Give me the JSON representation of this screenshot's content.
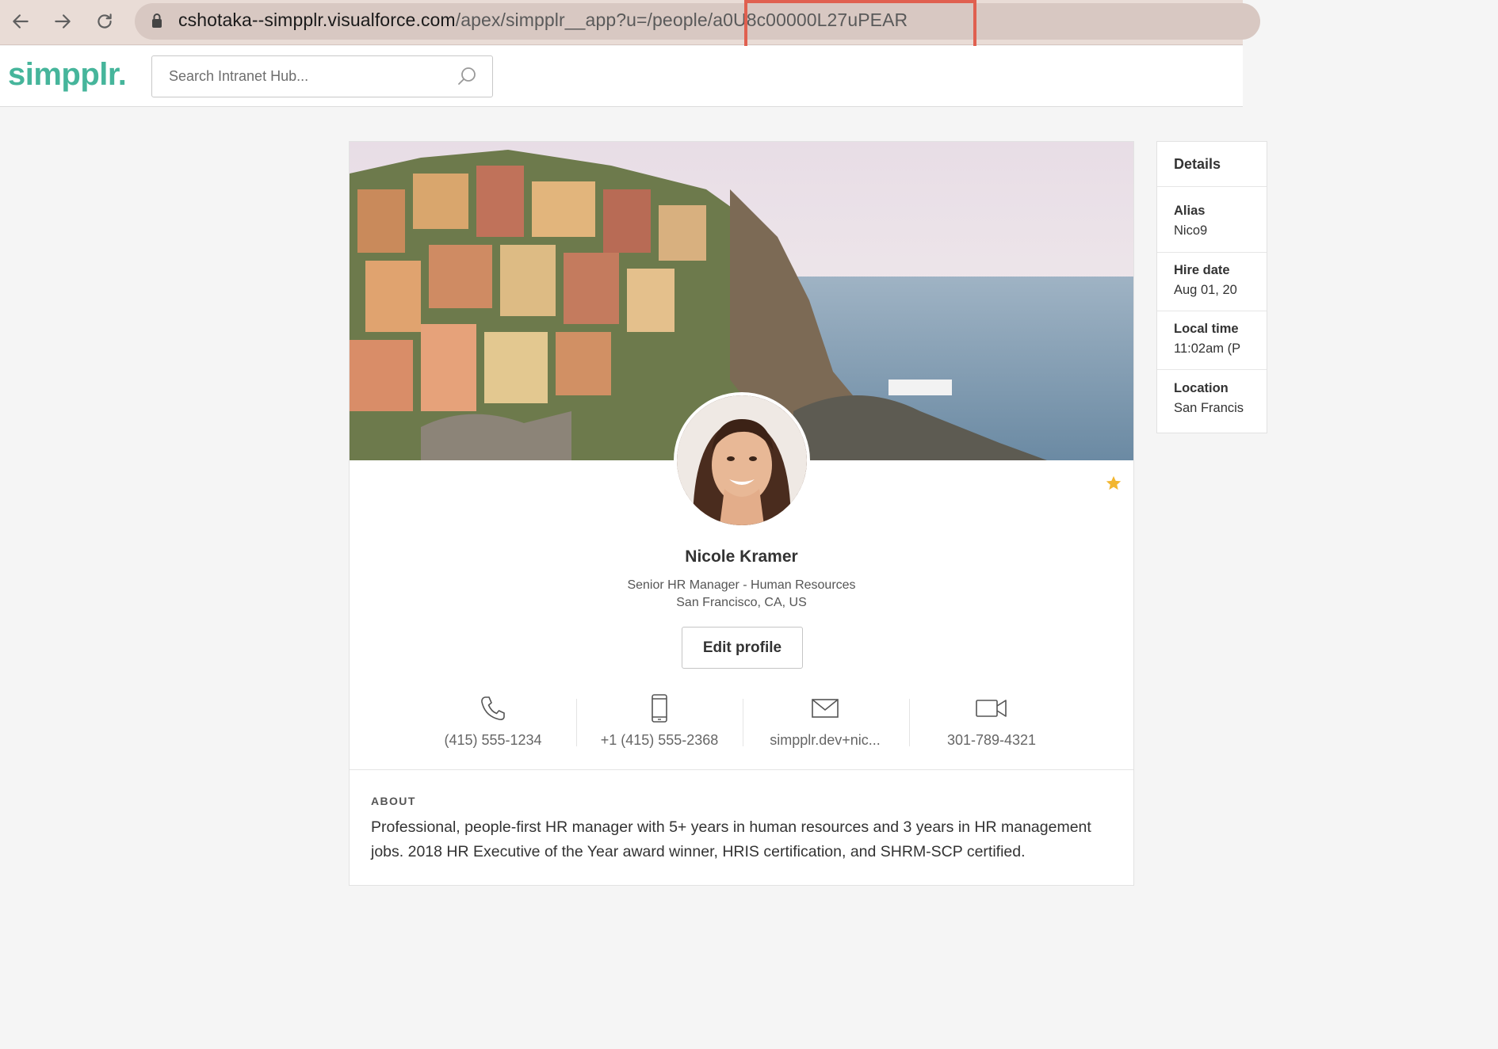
{
  "browser": {
    "url_main": "cshotaka--simpplr.visualforce.com",
    "url_path": "/apex/simpplr__app?u=/people/",
    "url_id": "a0U8c00000L27uPEAR"
  },
  "header": {
    "logo": "simpplr.",
    "search_placeholder": "Search Intranet Hub..."
  },
  "profile": {
    "name": "Nicole Kramer",
    "title": "Senior HR Manager - Human Resources",
    "location": "San Francisco, CA, US",
    "edit_label": "Edit profile",
    "contacts": [
      {
        "icon": "phone-icon",
        "value": "(415) 555-1234"
      },
      {
        "icon": "mobile-icon",
        "value": "+1 (415) 555-2368"
      },
      {
        "icon": "email-icon",
        "value": "simpplr.dev+nic..."
      },
      {
        "icon": "video-icon",
        "value": "301-789-4321"
      }
    ],
    "about_heading": "ABOUT",
    "about_text": "Professional, people-first HR manager with 5+ years in human resources and 3 years in HR management jobs. 2018 HR Executive of the Year award winner, HRIS certification, and SHRM-SCP certified."
  },
  "details": {
    "heading": "Details",
    "items": [
      {
        "label": "Alias",
        "value": "Nico9"
      },
      {
        "label": "Hire date",
        "value": "Aug 01, 20"
      },
      {
        "label": "Local time",
        "value": "11:02am (P"
      },
      {
        "label": "Location",
        "value": "San Francis"
      }
    ]
  },
  "colors": {
    "brand": "#46b59b",
    "star": "#f2b630",
    "url_highlight": "#e06050"
  }
}
